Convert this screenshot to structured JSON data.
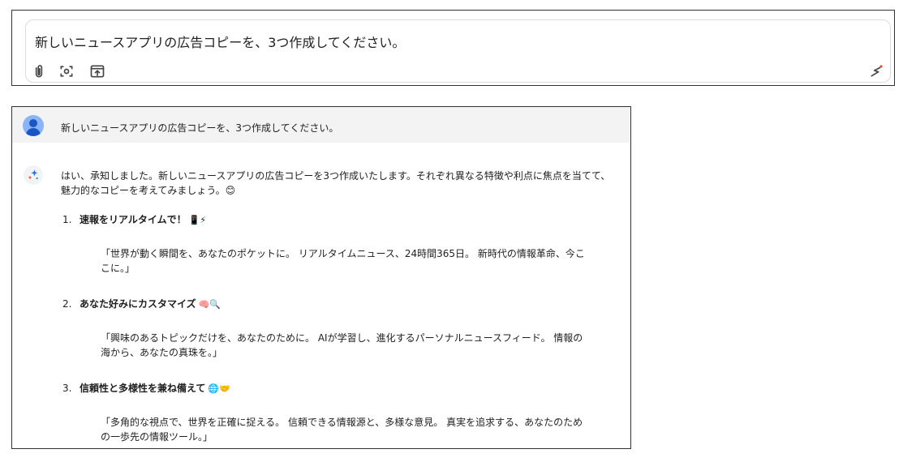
{
  "prompt": {
    "text": "新しいニュースアプリの広告コピーを、3つ作成してください。"
  },
  "chat": {
    "user_message": "新しいニュースアプリの広告コピーを、3つ作成してください。",
    "ai_intro": "はい、承知しました。新しいニュースアプリの広告コピーを3つ作成いたします。それぞれ異なる特徴や利点に焦点を当てて、魅力的なコピーを考えてみましょう。😊",
    "items": [
      {
        "number": "1.",
        "title": "速報をリアルタイムで！",
        "emoji": "📱⚡",
        "quote": "「世界が動く瞬間を、あなたのポケットに。 リアルタイムニュース、24時間365日。 新時代の情報革命、今ここに。」"
      },
      {
        "number": "2.",
        "title": "あなた好みにカスタマイズ",
        "emoji": "🧠🔍",
        "quote": "「興味のあるトピックだけを、あなたのために。 AIが学習し、進化するパーソナルニュースフィード。 情報の海から、あなたの真珠を。」"
      },
      {
        "number": "3.",
        "title": "信頼性と多様性を兼ね備えて",
        "emoji": "🌐🤝",
        "quote": "「多角的な視点で、世界を正確に捉える。 信頼できる情報源と、多様な意見。 真実を追求する、あなたのための一歩先の情報ツール。」"
      }
    ]
  }
}
